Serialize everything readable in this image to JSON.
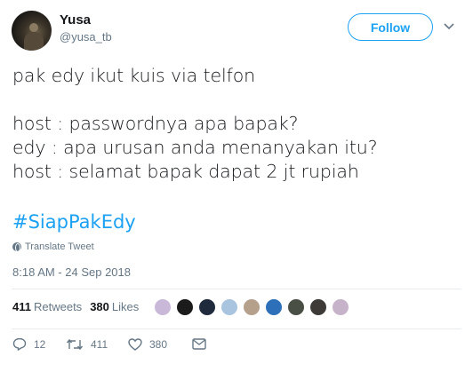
{
  "user": {
    "display_name": "Yusa",
    "handle": "@yusa_tb"
  },
  "follow_label": "Follow",
  "tweet": {
    "lines": [
      "pak edy ikut kuis via telfon",
      "",
      "host : passwordnya apa bapak?",
      "edy : apa urusan anda menanyakan itu?",
      "host : selamat bapak dapat 2 jt rupiah"
    ],
    "hashtag": "#SiapPakEdy"
  },
  "translate_label": "Translate Tweet",
  "timestamp": "8:18 AM - 24 Sep 2018",
  "stats": {
    "retweets_count": "411",
    "retweets_label": "Retweets",
    "likes_count": "380",
    "likes_label": "Likes"
  },
  "likers": [
    {
      "color": "#c9b8d8"
    },
    {
      "color": "#1b1b1b"
    },
    {
      "color": "#1f2a3d"
    },
    {
      "color": "#a8c4de"
    },
    {
      "color": "#b5a08c"
    },
    {
      "color": "#2d6fb8"
    },
    {
      "color": "#4a4f46"
    },
    {
      "color": "#3d3a38"
    },
    {
      "color": "#c7b3c9"
    }
  ],
  "actions": {
    "reply_count": "12",
    "retweet_count": "411",
    "like_count": "380"
  },
  "colors": {
    "accent": "#1da1f2",
    "secondary_text": "#657786",
    "primary_text": "#14171a"
  }
}
